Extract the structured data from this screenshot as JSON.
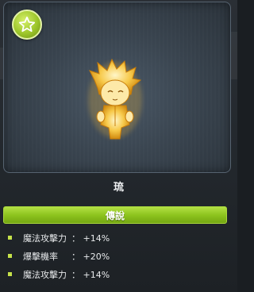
{
  "item": {
    "name": "琉",
    "grade": "傳說",
    "grade_color": "#8dc41e",
    "badge_icon": "star-icon"
  },
  "stats": [
    {
      "label": "魔法攻擊力",
      "value": "： +14%"
    },
    {
      "label": "爆擊機率",
      "value": "： +20%"
    },
    {
      "label": "魔法攻擊力",
      "value": "： +14%"
    }
  ]
}
